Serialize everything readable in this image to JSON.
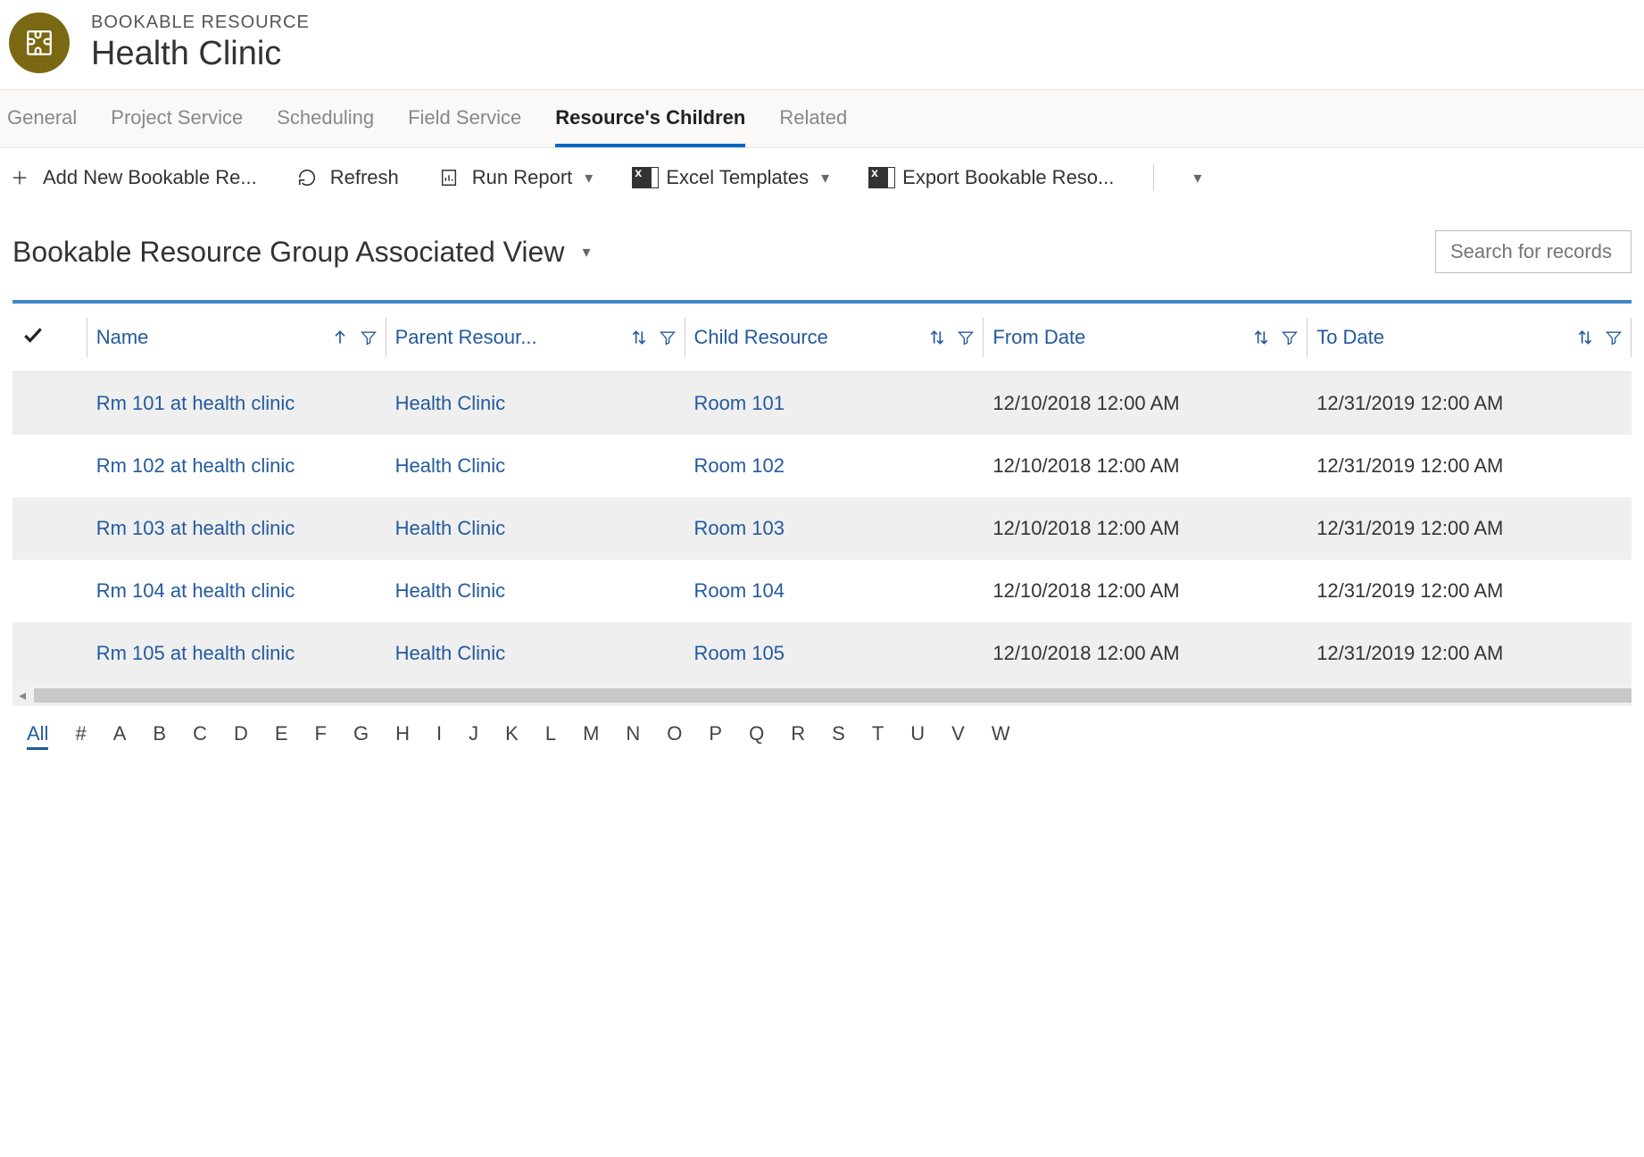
{
  "header": {
    "entity_type": "BOOKABLE RESOURCE",
    "title": "Health Clinic"
  },
  "tabs": [
    {
      "label": "General",
      "active": false
    },
    {
      "label": "Project Service",
      "active": false
    },
    {
      "label": "Scheduling",
      "active": false
    },
    {
      "label": "Field Service",
      "active": false
    },
    {
      "label": "Resource's Children",
      "active": true
    },
    {
      "label": "Related",
      "active": false
    }
  ],
  "toolbar": {
    "add": "Add New Bookable Re...",
    "refresh": "Refresh",
    "run_report": "Run Report",
    "excel_templates": "Excel Templates",
    "export": "Export Bookable Reso..."
  },
  "view": {
    "title": "Bookable Resource Group Associated View",
    "search_placeholder": "Search for records"
  },
  "columns": {
    "name": "Name",
    "parent": "Parent Resour...",
    "child": "Child Resource",
    "from": "From Date",
    "to": "To Date"
  },
  "rows": [
    {
      "name": "Rm 101 at health clinic",
      "parent": "Health Clinic",
      "child": "Room 101",
      "from": "12/10/2018 12:00 AM",
      "to": "12/31/2019 12:00 AM"
    },
    {
      "name": "Rm 102 at health clinic",
      "parent": "Health Clinic",
      "child": "Room 102",
      "from": "12/10/2018 12:00 AM",
      "to": "12/31/2019 12:00 AM"
    },
    {
      "name": "Rm 103 at health clinic",
      "parent": "Health Clinic",
      "child": "Room 103",
      "from": "12/10/2018 12:00 AM",
      "to": "12/31/2019 12:00 AM"
    },
    {
      "name": "Rm 104 at health clinic",
      "parent": "Health Clinic",
      "child": "Room 104",
      "from": "12/10/2018 12:00 AM",
      "to": "12/31/2019 12:00 AM"
    },
    {
      "name": "Rm 105 at health clinic",
      "parent": "Health Clinic",
      "child": "Room 105",
      "from": "12/10/2018 12:00 AM",
      "to": "12/31/2019 12:00 AM"
    }
  ],
  "alpha_filter": {
    "active": "All",
    "items": [
      "All",
      "#",
      "A",
      "B",
      "C",
      "D",
      "E",
      "F",
      "G",
      "H",
      "I",
      "J",
      "K",
      "L",
      "M",
      "N",
      "O",
      "P",
      "Q",
      "R",
      "S",
      "T",
      "U",
      "V",
      "W"
    ]
  }
}
